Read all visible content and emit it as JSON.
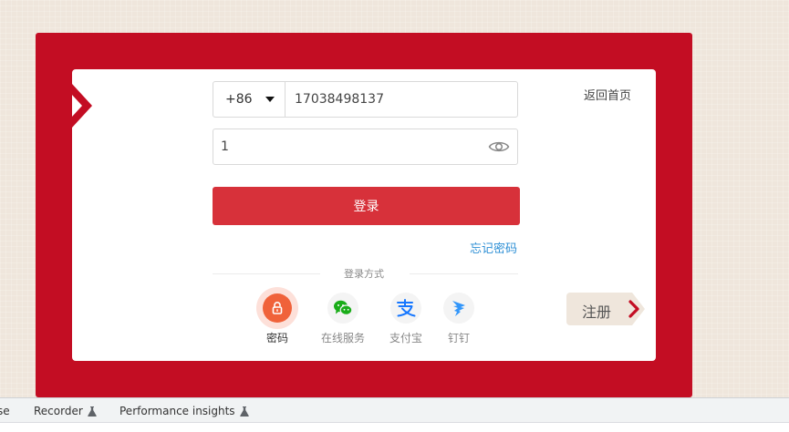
{
  "header": {
    "home_link": "返回首页"
  },
  "login_form": {
    "country_code": "+86",
    "phone_value": "17038498137",
    "password_value": "1",
    "login_button": "登录",
    "forgot_password": "忘记密码",
    "methods_label": "登录方式"
  },
  "methods": [
    {
      "label": "密码",
      "icon": "lock-icon",
      "active": true
    },
    {
      "label": "在线服务",
      "icon": "wechat-icon",
      "active": false
    },
    {
      "label": "支付宝",
      "icon": "alipay-icon",
      "active": false
    },
    {
      "label": "钉钉",
      "icon": "dingtalk-icon",
      "active": false
    }
  ],
  "register_tag": {
    "label": "注册"
  },
  "devtools": {
    "tabs": [
      {
        "label": "se"
      },
      {
        "label": "Recorder"
      },
      {
        "label": "Performance insights"
      }
    ]
  },
  "colors": {
    "frame_red": "#c30d23",
    "button_red": "#d7313a",
    "link_blue": "#2d8fd5",
    "active_orange": "#f0623a",
    "wechat_green": "#1aad19",
    "alipay_blue": "#1677ff",
    "dingtalk_blue": "#3296fa"
  }
}
